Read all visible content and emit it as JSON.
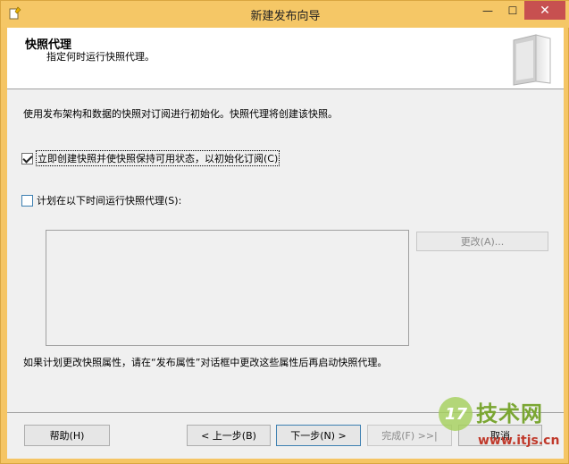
{
  "window": {
    "title": "新建发布向导",
    "controls": {
      "min": "—",
      "max": "☐",
      "close": "✕"
    }
  },
  "header": {
    "title": "快照代理",
    "subtitle": "指定何时运行快照代理。"
  },
  "body": {
    "description": "使用发布架构和数据的快照对订阅进行初始化。快照代理将创建该快照。",
    "checkbox_create_snapshot": {
      "label": "立即创建快照并使快照保持可用状态，以初始化订阅(C)",
      "checked": true
    },
    "checkbox_schedule": {
      "label": "计划在以下时间运行快照代理(S):",
      "checked": false
    },
    "change_button": "更改(A)...",
    "note": "如果计划更改快照属性，请在“发布属性”对话框中更改这些属性后再启动快照代理。"
  },
  "footer": {
    "help": "帮助(H)",
    "back": "< 上一步(B)",
    "next": "下一步(N) >",
    "finish": "完成(F) >>|",
    "cancel": "取消"
  },
  "watermark": {
    "logo_number": "17",
    "brand": "技术网",
    "url": "www.itjs.cn"
  },
  "colors": {
    "titlebar": "#f5c766",
    "close": "#c75050",
    "client": "#f0f0f0",
    "focus_border": "#3c7fb1"
  }
}
